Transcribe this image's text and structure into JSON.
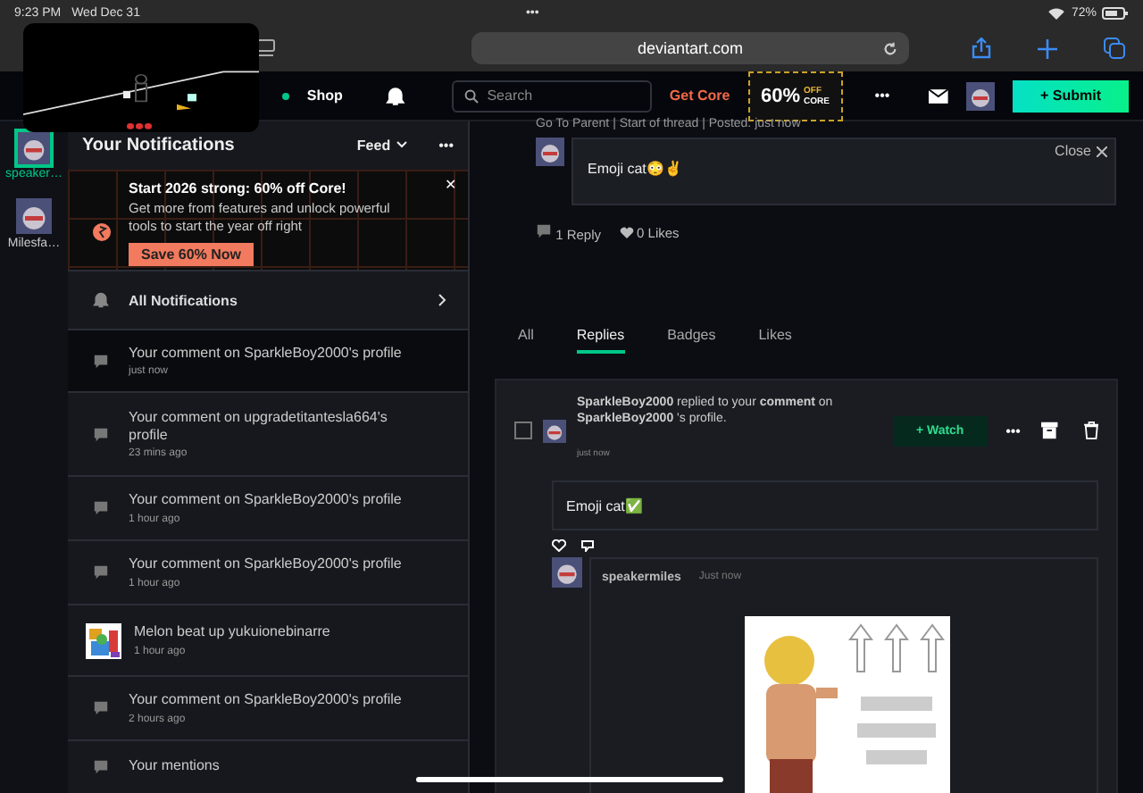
{
  "status_bar": {
    "time": "9:23 PM",
    "date": "Wed Dec 31",
    "dots": "•••",
    "battery": "72%"
  },
  "browser": {
    "url": "deviantart.com"
  },
  "nav": {
    "shop": "Shop",
    "search": {
      "placeholder": "Search"
    },
    "get_core": "Get Core",
    "promo": {
      "percent": "60%",
      "off": "OFF",
      "core": "CORE"
    },
    "more": "•••",
    "submit": "+ Submit"
  },
  "rail": [
    {
      "name": "speaker…",
      "selected": true
    },
    {
      "name": "Milesfa…",
      "selected": false
    }
  ],
  "notifications": {
    "title": "Your Notifications",
    "feed": "Feed",
    "more": "•••",
    "promo": {
      "title": "Start 2026 strong: 60% off Core!",
      "text": "Get more from features and unlock powerful tools to start the year off right",
      "button": "Save 60% Now",
      "close": "✕"
    },
    "all": "All Notifications",
    "items": [
      {
        "kind": "comment",
        "text": "Your comment on SparkleBoy2000's profile",
        "time": "just now",
        "selected": true
      },
      {
        "kind": "comment",
        "text": "Your comment on upgradetitantesla664's profile",
        "time": "23 mins ago",
        "selected": false
      },
      {
        "kind": "comment",
        "text": "Your comment on SparkleBoy2000's profile",
        "time": "1 hour ago",
        "selected": false
      },
      {
        "kind": "comment",
        "text": "Your comment on SparkleBoy2000's profile",
        "time": "1 hour ago",
        "selected": false
      },
      {
        "kind": "deviation",
        "text": "Melon beat up yukuionebinarre",
        "time": "1 hour ago",
        "selected": false
      },
      {
        "kind": "comment",
        "text": "Your comment on SparkleBoy2000's profile",
        "time": "2 hours ago",
        "selected": false
      },
      {
        "kind": "comment",
        "text": "Your mentions",
        "selected": false
      }
    ]
  },
  "detail": {
    "thread_links": "Go To Parent | Start of thread | Posted: just now",
    "close": "Close",
    "comment": "Emoji cat😳✌️",
    "replies": "1 Reply",
    "likes": "0 Likes",
    "tabs": [
      {
        "label": "All",
        "selected": false
      },
      {
        "label": "Replies",
        "selected": true
      },
      {
        "label": "Badges",
        "selected": false
      },
      {
        "label": "Likes",
        "selected": false
      }
    ],
    "card": {
      "checked": false,
      "header": "**SparkleBoy2000** replied to your **comment** on **SparkleBoy2000** 's profile.",
      "time": "just now",
      "watch": "+ Watch",
      "more": "•••",
      "body": "Emoji cat✅",
      "reply": {
        "user": "speakermiles",
        "time": "Just now"
      }
    }
  }
}
